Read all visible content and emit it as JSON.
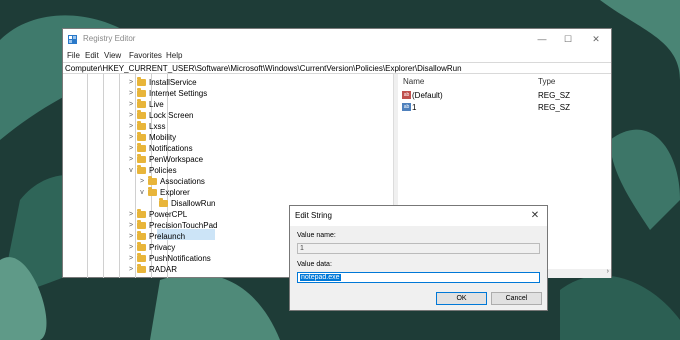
{
  "window": {
    "title": "Registry Editor",
    "controls": {
      "minimize": "—",
      "maximize": "☐",
      "close": "✕"
    }
  },
  "menu": [
    "File",
    "Edit",
    "View",
    "Favorites",
    "Help"
  ],
  "address": "Computer\\HKEY_CURRENT_USER\\Software\\Microsoft\\Windows\\CurrentVersion\\Policies\\Explorer\\DisallowRun",
  "tree": {
    "items": [
      {
        "label": "InstallService",
        "expander": ">"
      },
      {
        "label": "Internet Settings",
        "expander": ">"
      },
      {
        "label": "Live",
        "expander": ">"
      },
      {
        "label": "Lock Screen",
        "expander": ">"
      },
      {
        "label": "Lxss",
        "expander": ">"
      },
      {
        "label": "Mobility",
        "expander": ">"
      },
      {
        "label": "Notifications",
        "expander": ">"
      },
      {
        "label": "PenWorkspace",
        "expander": ">"
      },
      {
        "label": "Policies",
        "expander": "v"
      },
      {
        "label": "Associations",
        "expander": ">"
      },
      {
        "label": "Explorer",
        "expander": "v"
      },
      {
        "label": "DisallowRun",
        "expander": ""
      },
      {
        "label": "PowerCPL",
        "expander": ">"
      },
      {
        "label": "PrecisionTouchPad",
        "expander": ">"
      },
      {
        "label": "Prelaunch",
        "expander": ">"
      },
      {
        "label": "Privacy",
        "expander": ">"
      },
      {
        "label": "PushNotifications",
        "expander": ">"
      },
      {
        "label": "RADAR",
        "expander": ">"
      }
    ]
  },
  "values_list": {
    "headers": {
      "name": "Name",
      "type": "Type"
    },
    "rows": [
      {
        "name": "(Default)",
        "type": "REG_SZ",
        "icon": "ab"
      },
      {
        "name": "1",
        "type": "REG_SZ",
        "icon": "ab"
      }
    ]
  },
  "dialog": {
    "title": "Edit String",
    "close": "✕",
    "value_name_label": "Value name:",
    "value_name": "1",
    "value_data_label": "Value data:",
    "value_data": "notepad.exe",
    "ok": "OK",
    "cancel": "Cancel"
  },
  "colors": {
    "folder": "#e8b53a",
    "selection": "#0078d7",
    "tree_selected": "#cce4f7"
  }
}
